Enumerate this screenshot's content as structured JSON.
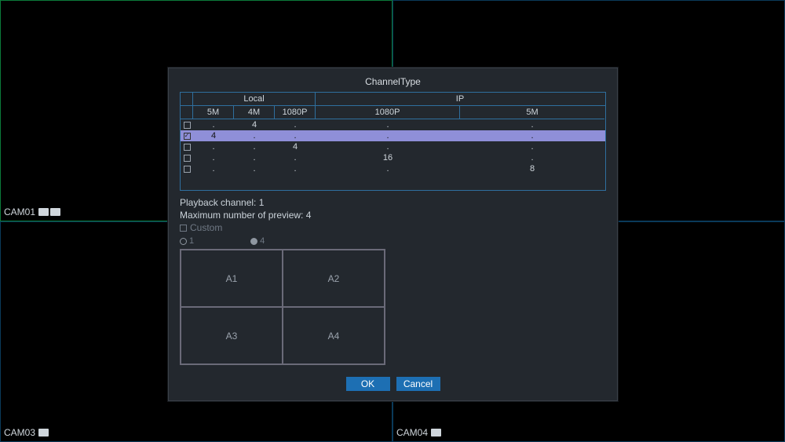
{
  "quadrants": {
    "tl": {
      "label": "CAM01",
      "has_speaker_icon": true,
      "has_camera_icon": true
    },
    "tr": {
      "label": ""
    },
    "bl": {
      "label": "CAM03",
      "has_camera_icon": true
    },
    "br": {
      "label": "CAM04",
      "has_camera_icon": true
    }
  },
  "dialog": {
    "title": "ChannelType",
    "table": {
      "groups": {
        "local": "Local",
        "ip": "IP"
      },
      "columns": {
        "local": [
          "5M",
          "4M",
          "1080P"
        ],
        "ip": [
          "1080P",
          "5M"
        ]
      },
      "rows": [
        {
          "checked": false,
          "local_5m": ".",
          "local_4m": "4",
          "local_1080p": ".",
          "ip_1080p": ".",
          "ip_5m": "."
        },
        {
          "checked": true,
          "local_5m": "4",
          "local_4m": ".",
          "local_1080p": ".",
          "ip_1080p": ".",
          "ip_5m": "."
        },
        {
          "checked": false,
          "local_5m": ".",
          "local_4m": ".",
          "local_1080p": "4",
          "ip_1080p": ".",
          "ip_5m": "."
        },
        {
          "checked": false,
          "local_5m": ".",
          "local_4m": ".",
          "local_1080p": ".",
          "ip_1080p": "16",
          "ip_5m": "."
        },
        {
          "checked": false,
          "local_5m": ".",
          "local_4m": ".",
          "local_1080p": ".",
          "ip_1080p": ".",
          "ip_5m": "8"
        }
      ],
      "selected_index": 1
    },
    "playback_label": "Playback channel: 1",
    "max_preview_label": "Maximum number of preview: 4",
    "custom_label": "Custom",
    "custom_checked": false,
    "layout_options": [
      {
        "label": "1",
        "checked": false
      },
      {
        "label": "4",
        "checked": true
      }
    ],
    "preview_cells": [
      "A1",
      "A2",
      "A3",
      "A4"
    ],
    "buttons": {
      "ok": "OK",
      "cancel": "Cancel"
    }
  }
}
